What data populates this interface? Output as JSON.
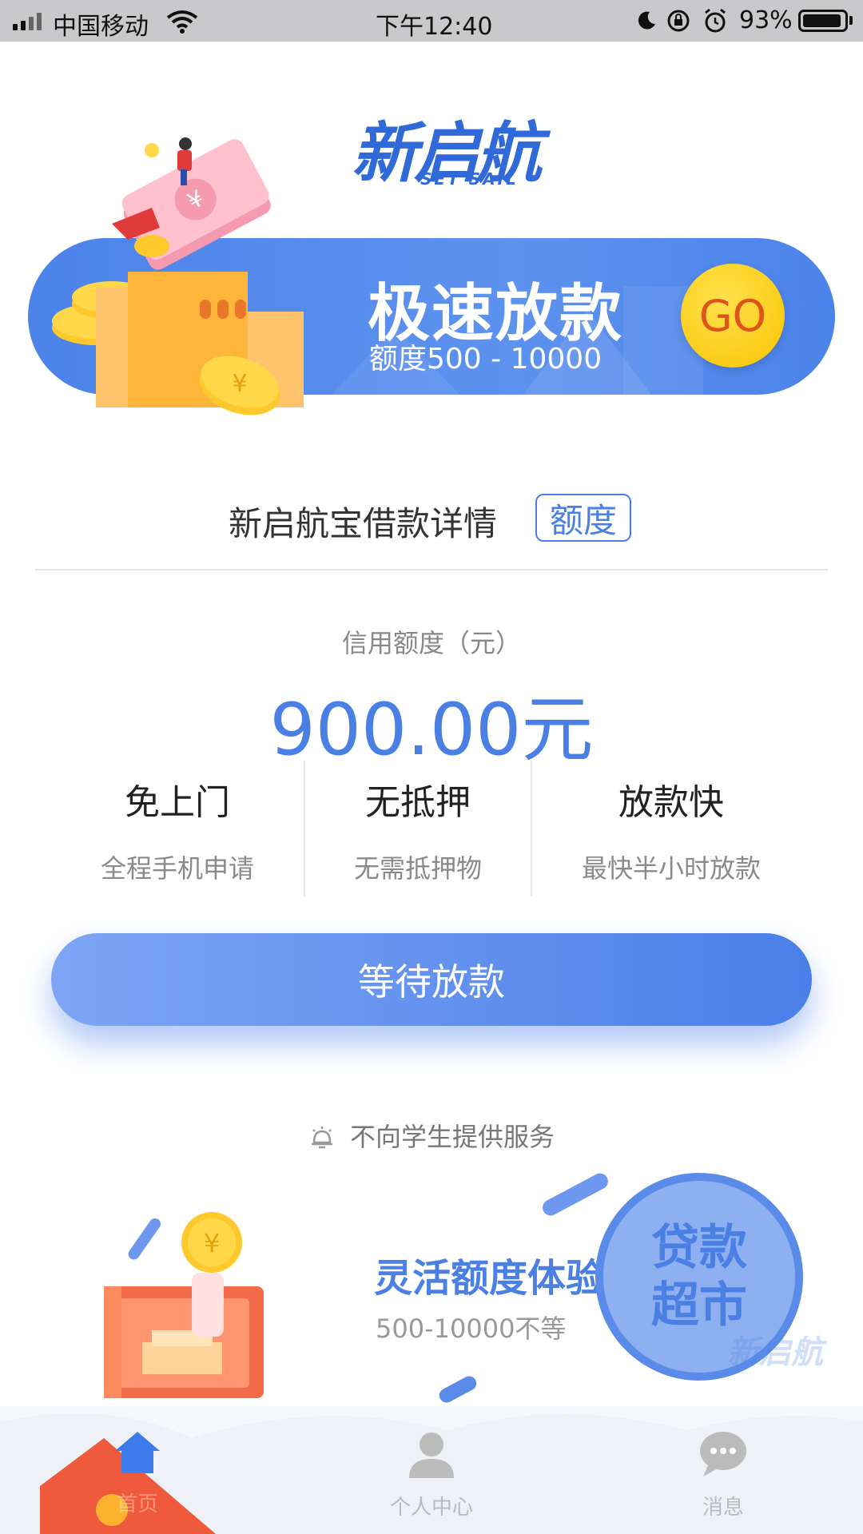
{
  "status_bar": {
    "carrier": "中国移动",
    "time": "下午12:40",
    "battery_percent": "93%",
    "battery_level": 0.93
  },
  "logo": {
    "cn": "新启航",
    "en": "SET SAIL"
  },
  "banner": {
    "title": "极速放款",
    "subtitle": "额度500 - 10000",
    "go_label": "GO"
  },
  "section": {
    "title": "新启航宝借款详情",
    "tag": "额度"
  },
  "credit": {
    "label": "信用额度（元）",
    "value": "900.00元"
  },
  "features": [
    {
      "title": "免上门",
      "desc": "全程手机申请"
    },
    {
      "title": "无抵押",
      "desc": "无需抵押物"
    },
    {
      "title": "放款快",
      "desc": "最快半小时放款"
    }
  ],
  "primary_button": {
    "label": "等待放款"
  },
  "notice": {
    "text": "不向学生提供服务"
  },
  "promo": {
    "title": "灵活额度体验",
    "subtitle": "500-10000不等",
    "market_line1": "贷款",
    "market_line2": "超市"
  },
  "tabs": [
    {
      "label": "首页",
      "icon": "home-icon"
    },
    {
      "label": "个人中心",
      "icon": "person-icon"
    },
    {
      "label": "消息",
      "icon": "message-icon"
    }
  ],
  "colors": {
    "accent": "#4a7fe3",
    "go_yellow": "#f9c300",
    "go_text": "#e0531c"
  }
}
